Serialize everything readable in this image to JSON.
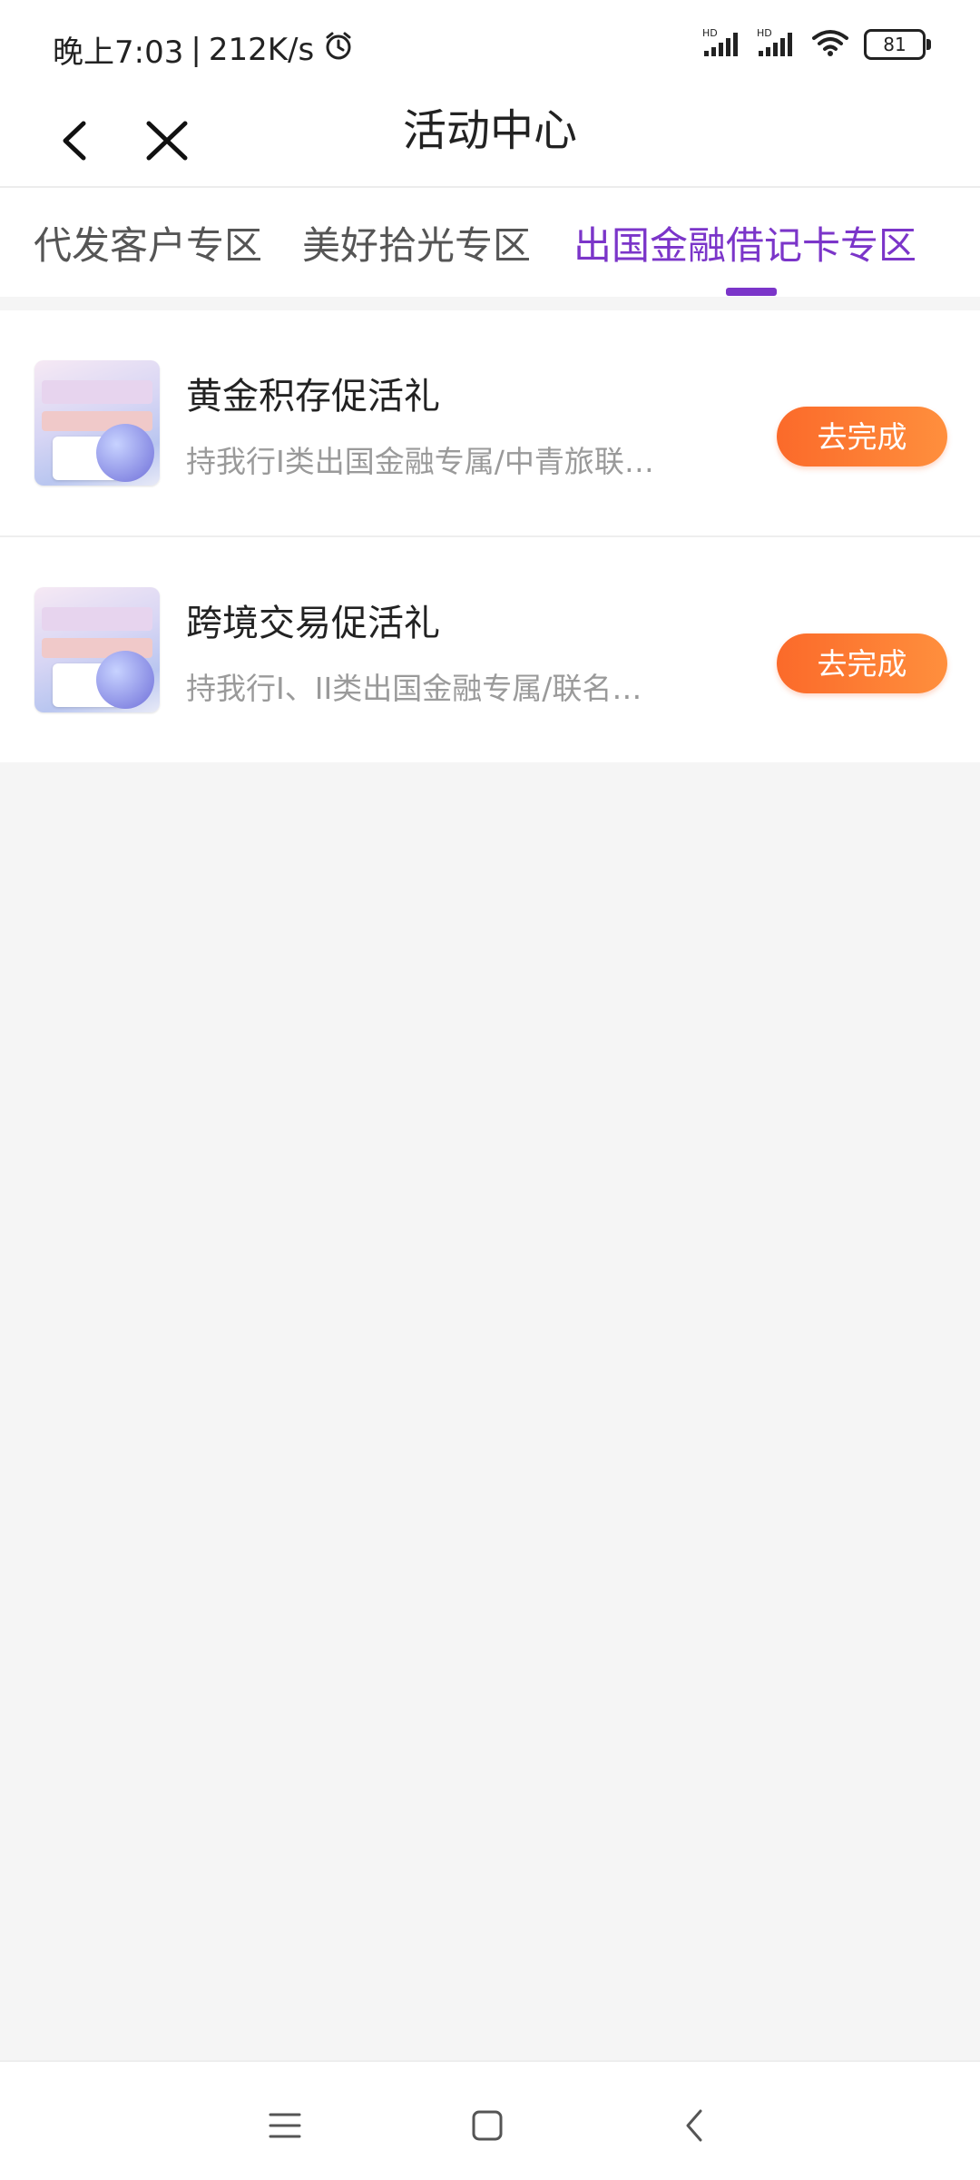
{
  "status_bar": {
    "time": "晚上7:03",
    "speed": "212K/s",
    "network_label": "HD",
    "battery": "81"
  },
  "header": {
    "title": "活动中心",
    "back_icon": "chevron-left-icon",
    "close_icon": "close-icon"
  },
  "tabs": [
    {
      "label": "代发客户专区",
      "active": false
    },
    {
      "label": "美好拾光专区",
      "active": false
    },
    {
      "label": "出国金融借记卡专区",
      "active": true
    }
  ],
  "activities": [
    {
      "title": "黄金积存促活礼",
      "description": "持我行I类出国金融专属/中青旅联…",
      "action": "去完成"
    },
    {
      "title": "跨境交易促活礼",
      "description": "持我行I、II类出国金融专属/联名…",
      "action": "去完成"
    }
  ],
  "nav_bar": {
    "menu_icon": "menu-icon",
    "home_icon": "home-square-icon",
    "back_icon": "back-triangle-icon"
  },
  "colors": {
    "accent": "#7b35c9",
    "button": "#fb6a2a",
    "background": "#f5f5f5"
  }
}
